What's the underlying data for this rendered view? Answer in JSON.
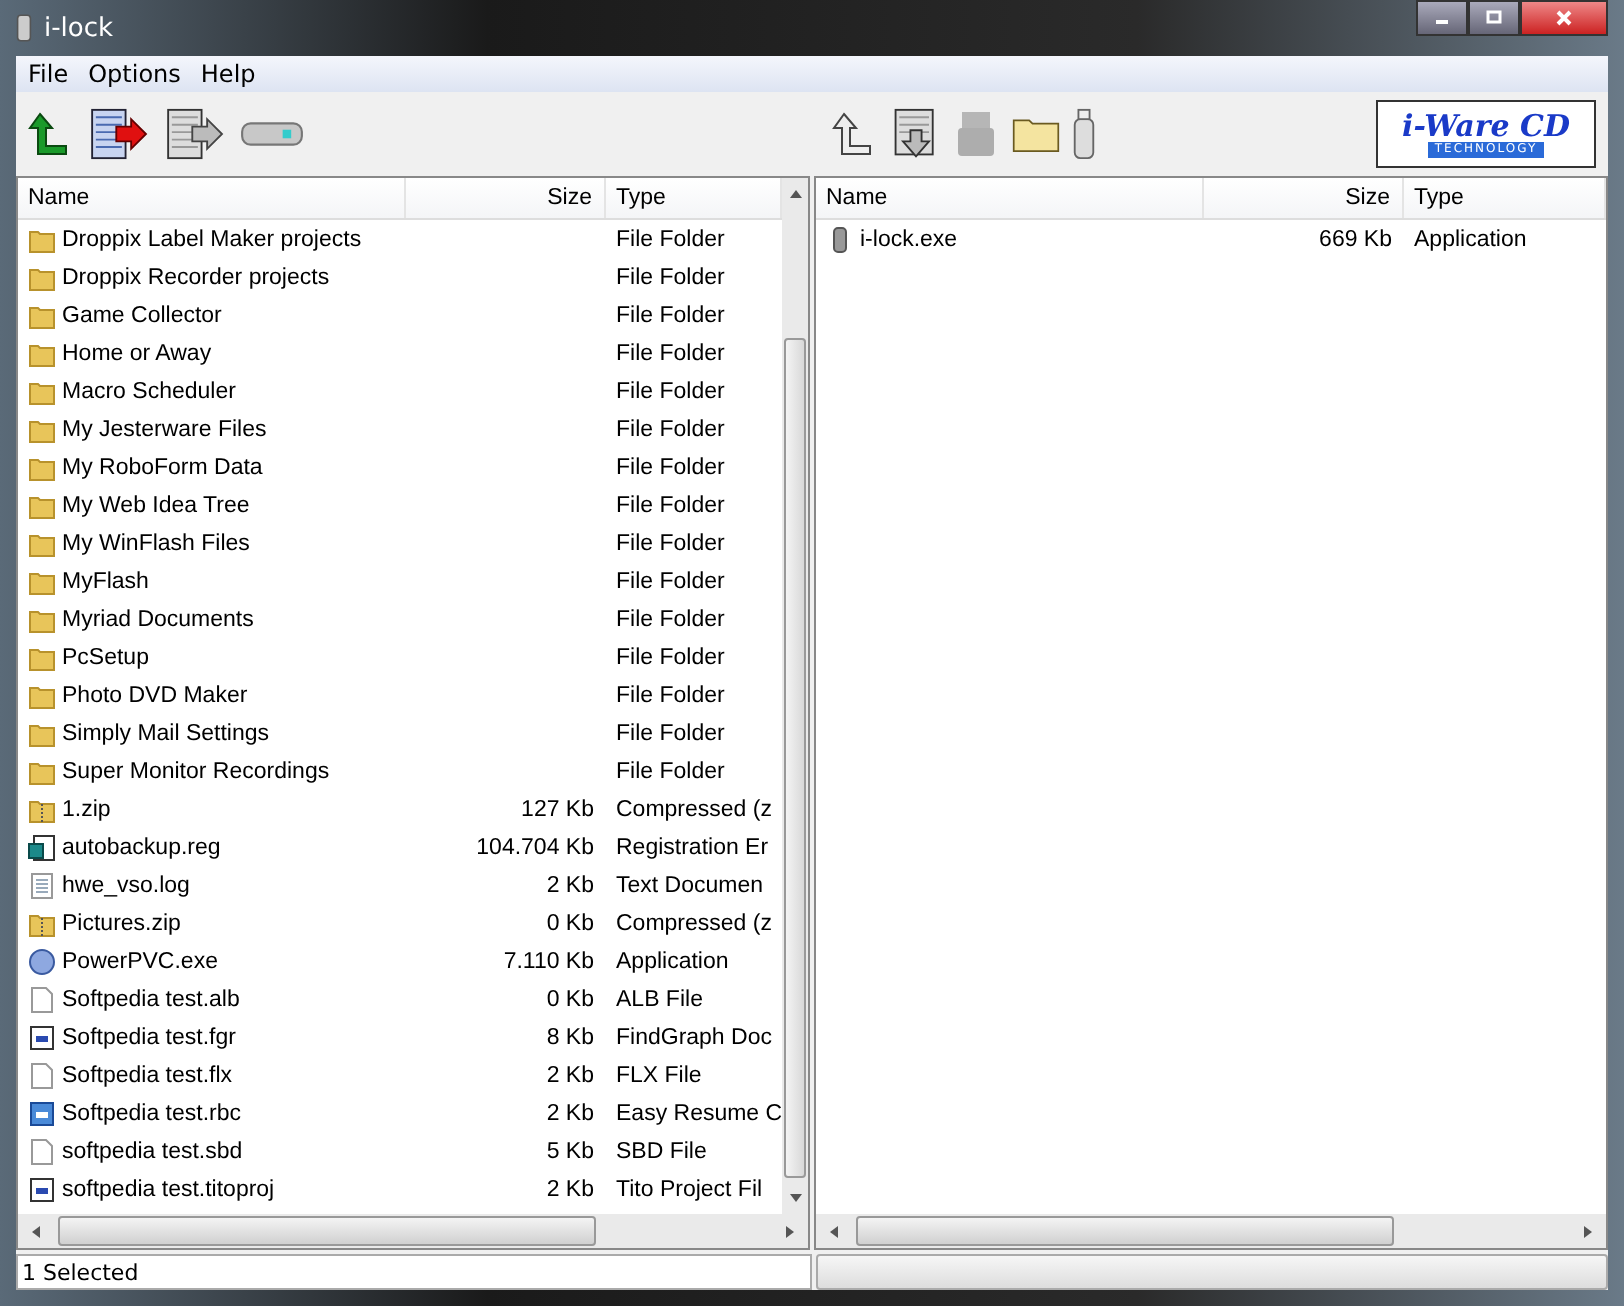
{
  "window": {
    "title": "i-lock"
  },
  "menu": [
    "File",
    "Options",
    "Help"
  ],
  "toolbar": {
    "logo": {
      "name": "i-Ware CD",
      "tagline": "TECHNOLOGY"
    },
    "left_tools": [
      {
        "kind": "up-green"
      },
      {
        "kind": "doc-red-arrow"
      },
      {
        "kind": "doc-gray-arrow"
      },
      {
        "kind": "drive"
      }
    ],
    "right_tools": [
      {
        "kind": "up-outline",
        "disabled": false
      },
      {
        "kind": "doc-down",
        "disabled": false
      },
      {
        "kind": "usb",
        "disabled": true
      },
      {
        "kind": "folder",
        "disabled": false
      },
      {
        "kind": "stick",
        "disabled": false
      }
    ]
  },
  "left_pane": {
    "columns": [
      "Name",
      "Size",
      "Type"
    ],
    "rows": [
      {
        "kind": "folder",
        "name": "Droppix Label Maker projects",
        "size": "",
        "type": "File Folder"
      },
      {
        "kind": "folder",
        "name": "Droppix Recorder projects",
        "size": "",
        "type": "File Folder"
      },
      {
        "kind": "folder",
        "name": "Game Collector",
        "size": "",
        "type": "File Folder"
      },
      {
        "kind": "folder",
        "name": "Home or Away",
        "size": "",
        "type": "File Folder"
      },
      {
        "kind": "folder",
        "name": "Macro Scheduler",
        "size": "",
        "type": "File Folder"
      },
      {
        "kind": "folder",
        "name": "My Jesterware Files",
        "size": "",
        "type": "File Folder"
      },
      {
        "kind": "folder",
        "name": "My RoboForm Data",
        "size": "",
        "type": "File Folder"
      },
      {
        "kind": "folder",
        "name": "My Web Idea Tree",
        "size": "",
        "type": "File Folder"
      },
      {
        "kind": "folder",
        "name": "My WinFlash Files",
        "size": "",
        "type": "File Folder"
      },
      {
        "kind": "folder",
        "name": "MyFlash",
        "size": "",
        "type": "File Folder"
      },
      {
        "kind": "folder",
        "name": "Myriad Documents",
        "size": "",
        "type": "File Folder"
      },
      {
        "kind": "folder",
        "name": "PcSetup",
        "size": "",
        "type": "File Folder"
      },
      {
        "kind": "folder",
        "name": "Photo DVD Maker",
        "size": "",
        "type": "File Folder"
      },
      {
        "kind": "folder",
        "name": "Simply Mail Settings",
        "size": "",
        "type": "File Folder"
      },
      {
        "kind": "folder",
        "name": "Super Monitor Recordings",
        "size": "",
        "type": "File Folder"
      },
      {
        "kind": "zip",
        "name": "1.zip",
        "size": "127 Kb",
        "type": "Compressed (z"
      },
      {
        "kind": "reg",
        "name": "autobackup.reg",
        "size": "104.704 Kb",
        "type": "Registration Er"
      },
      {
        "kind": "text",
        "name": "hwe_vso.log",
        "size": "2 Kb",
        "type": "Text Documen"
      },
      {
        "kind": "zip",
        "name": "Pictures.zip",
        "size": "0 Kb",
        "type": "Compressed (z"
      },
      {
        "kind": "exe",
        "name": "PowerPVC.exe",
        "size": "7.110 Kb",
        "type": "Application"
      },
      {
        "kind": "blank",
        "name": "Softpedia test.alb",
        "size": "0 Kb",
        "type": "ALB File"
      },
      {
        "kind": "appdoc",
        "name": "Softpedia test.fgr",
        "size": "8 Kb",
        "type": "FindGraph Doc"
      },
      {
        "kind": "blank",
        "name": "Softpedia test.flx",
        "size": "2 Kb",
        "type": "FLX File"
      },
      {
        "kind": "bluedoc",
        "name": "Softpedia test.rbc",
        "size": "2 Kb",
        "type": "Easy Resume C"
      },
      {
        "kind": "blank",
        "name": "softpedia test.sbd",
        "size": "5 Kb",
        "type": "SBD File"
      },
      {
        "kind": "appdoc",
        "name": "softpedia test.titoproj",
        "size": "2 Kb",
        "type": "Tito Project Fil"
      }
    ]
  },
  "right_pane": {
    "columns": [
      "Name",
      "Size",
      "Type"
    ],
    "rows": [
      {
        "kind": "stick",
        "name": "i-lock.exe",
        "size": "669 Kb",
        "type": "Application"
      }
    ]
  },
  "status_bar": {
    "text": "1 Selected"
  }
}
